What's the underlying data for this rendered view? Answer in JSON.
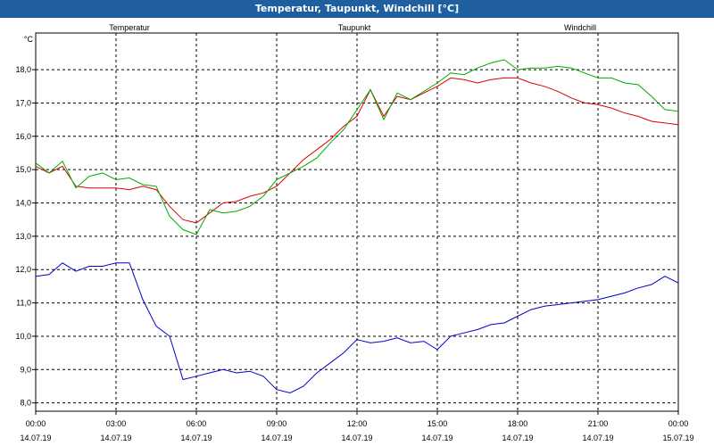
{
  "window": {
    "title": "Temperatur, Taupunkt, Windchill [°C]"
  },
  "chart_data": {
    "type": "line",
    "title": "Temperatur, Taupunkt, Windchill [°C]",
    "ylabel": "°C",
    "xlabel": "",
    "ylim": [
      7.75,
      19.1
    ],
    "xlim": [
      0,
      24
    ],
    "grid": true,
    "legend_placement": "top",
    "y_ticks": [
      "8,0",
      "9,0",
      "10,0",
      "11,0",
      "12,0",
      "13,0",
      "14,0",
      "15,0",
      "16,0",
      "17,0",
      "18,0"
    ],
    "x_ticks": [
      {
        "time": "00:00",
        "date": "14.07.19"
      },
      {
        "time": "03:00",
        "date": "14.07.19"
      },
      {
        "time": "06:00",
        "date": "14.07.19"
      },
      {
        "time": "09:00",
        "date": "14.07.19"
      },
      {
        "time": "12:00",
        "date": "14.07.19"
      },
      {
        "time": "15:00",
        "date": "14.07.19"
      },
      {
        "time": "18:00",
        "date": "14.07.19"
      },
      {
        "time": "21:00",
        "date": "14.07.19"
      },
      {
        "time": "00:00",
        "date": "15.07.19"
      }
    ],
    "series": [
      {
        "name": "Temperatur",
        "color": "#dd0000",
        "x": [
          0,
          0.5,
          1,
          1.5,
          2,
          2.5,
          3,
          3.5,
          4,
          4.5,
          5,
          5.5,
          6,
          6.5,
          7,
          7.5,
          8,
          8.5,
          9,
          9.5,
          10,
          10.5,
          11,
          11.5,
          12,
          12.5,
          13,
          13.5,
          14,
          14.5,
          15,
          15.5,
          16,
          16.5,
          17,
          17.5,
          18,
          18.5,
          19,
          19.5,
          20,
          20.5,
          21,
          21.5,
          22,
          22.5,
          23,
          23.5,
          24
        ],
        "values": [
          15.1,
          14.9,
          15.1,
          14.5,
          14.45,
          14.45,
          14.45,
          14.4,
          14.5,
          14.4,
          13.9,
          13.5,
          13.4,
          13.7,
          14.0,
          14.05,
          14.2,
          14.3,
          14.5,
          14.9,
          15.3,
          15.6,
          15.9,
          16.3,
          16.6,
          17.4,
          16.6,
          17.2,
          17.1,
          17.3,
          17.5,
          17.75,
          17.7,
          17.6,
          17.7,
          17.75,
          17.75,
          17.6,
          17.5,
          17.35,
          17.15,
          17.0,
          16.95,
          16.85,
          16.7,
          16.6,
          16.45,
          16.4,
          16.35
        ]
      },
      {
        "name": "Taupunkt",
        "color": "#0000cc",
        "x": [
          0,
          0.5,
          1,
          1.5,
          2,
          2.5,
          3,
          3.5,
          4,
          4.5,
          5,
          5.5,
          6,
          6.5,
          7,
          7.5,
          8,
          8.5,
          9,
          9.5,
          10,
          10.5,
          11,
          11.5,
          12,
          12.5,
          13,
          13.5,
          14,
          14.5,
          15,
          15.5,
          16,
          16.5,
          17,
          17.5,
          18,
          18.5,
          19,
          19.5,
          20,
          20.5,
          21,
          21.5,
          22,
          22.5,
          23,
          23.5,
          24
        ],
        "values": [
          11.8,
          11.85,
          12.2,
          11.95,
          12.1,
          12.1,
          12.2,
          12.2,
          11.1,
          10.3,
          10.0,
          8.7,
          8.8,
          8.9,
          9.0,
          8.9,
          8.95,
          8.8,
          8.4,
          8.3,
          8.5,
          8.9,
          9.2,
          9.5,
          9.9,
          9.8,
          9.85,
          9.95,
          9.8,
          9.85,
          9.6,
          10.0,
          10.1,
          10.2,
          10.35,
          10.4,
          10.6,
          10.8,
          10.9,
          10.95,
          11.0,
          11.05,
          11.1,
          11.2,
          11.3,
          11.45,
          11.55,
          11.8,
          11.6
        ]
      },
      {
        "name": "Windchill",
        "color": "#00aa00",
        "x": [
          0,
          0.5,
          1,
          1.5,
          2,
          2.5,
          3,
          3.5,
          4,
          4.5,
          5,
          5.5,
          6,
          6.5,
          7,
          7.5,
          8,
          8.5,
          9,
          9.5,
          10,
          10.5,
          11,
          11.5,
          12,
          12.5,
          13,
          13.5,
          14,
          14.5,
          15,
          15.5,
          16,
          16.5,
          17,
          17.5,
          18,
          18.5,
          19,
          19.5,
          20,
          20.5,
          21,
          21.5,
          22,
          22.5,
          23,
          23.5,
          24
        ],
        "values": [
          15.2,
          14.9,
          15.25,
          14.45,
          14.8,
          14.9,
          14.7,
          14.75,
          14.55,
          14.5,
          13.6,
          13.2,
          13.05,
          13.8,
          13.7,
          13.75,
          13.9,
          14.2,
          14.7,
          14.9,
          15.1,
          15.35,
          15.8,
          16.2,
          16.8,
          17.4,
          16.5,
          17.3,
          17.1,
          17.35,
          17.6,
          17.9,
          17.85,
          18.05,
          18.2,
          18.3,
          18.0,
          18.05,
          18.05,
          18.1,
          18.05,
          17.9,
          17.75,
          17.75,
          17.6,
          17.55,
          17.2,
          16.8,
          16.75
        ]
      }
    ]
  }
}
